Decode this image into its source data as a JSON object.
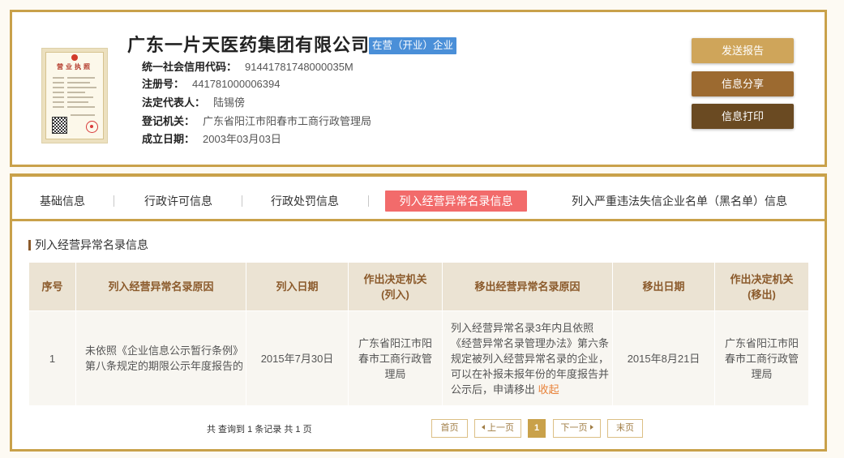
{
  "colors": {
    "gold": "#c9a14a",
    "badge": "#4a8fd8",
    "active_tab": "#f26b6b",
    "link": "#e8823a",
    "btn_send": "#cfa55a",
    "btn_share": "#9c6a30",
    "btn_print": "#6a4a22",
    "head_bg": "#ebe3d3",
    "row_bg": "#f8f6f1",
    "head_text": "#8b5a2b"
  },
  "company": {
    "license_image": {
      "title": "营业执照"
    },
    "name": "广东一片天医药集团有限公司",
    "status_badge": "在营（开业）企业",
    "fields": [
      {
        "label": "统一社会信用代码：",
        "value": "91441781748000035M"
      },
      {
        "label": "注册号：",
        "value": "441781000006394"
      },
      {
        "label": "法定代表人：",
        "value": "陆锡傍"
      },
      {
        "label": "登记机关：",
        "value": "广东省阳江市阳春市工商行政管理局"
      },
      {
        "label": "成立日期：",
        "value": "2003年03月03日"
      }
    ]
  },
  "actions": {
    "send_report": "发送报告",
    "share": "信息分享",
    "print": "信息打印"
  },
  "tabs": [
    {
      "label": "基础信息",
      "active": false
    },
    {
      "label": "行政许可信息",
      "active": false
    },
    {
      "label": "行政处罚信息",
      "active": false
    },
    {
      "label": "列入经营异常名录信息",
      "active": true
    },
    {
      "label": "列入严重违法失信企业名单（黑名单）信息",
      "active": false
    }
  ],
  "section": {
    "title": "列入经营异常名录信息"
  },
  "table": {
    "headers": {
      "seq": "序号",
      "list_reason": "列入经营异常名录原因",
      "list_date": "列入日期",
      "list_authority": [
        "作出决定机关",
        "(列入)"
      ],
      "remove_reason": "移出经营异常名录原因",
      "remove_date": "移出日期",
      "remove_authority": [
        "作出决定机关",
        "(移出)"
      ]
    },
    "rows": [
      {
        "seq": "1",
        "list_reason": "未依照《企业信息公示暂行条例》第八条规定的期限公示年度报告的",
        "list_date": "2015年7月30日",
        "list_authority": "广东省阳江市阳春市工商行政管理局",
        "remove_reason": "列入经营异常名录3年内且依照《经营异常名录管理办法》第六条规定被列入经营异常名录的企业，可以在补报未报年份的年度报告并公示后，申请移出",
        "collapse_link": "收起",
        "remove_date": "2015年8月21日",
        "remove_authority": "广东省阳江市阳春市工商行政管理局"
      }
    ]
  },
  "pagination": {
    "summary": "共 查询到 1 条记录 共 1 页",
    "first": "首页",
    "prev": "上一页",
    "prev_icon": "chevron-left-icon",
    "current": "1",
    "next": "下一页",
    "next_icon": "chevron-right-icon",
    "last": "末页"
  }
}
